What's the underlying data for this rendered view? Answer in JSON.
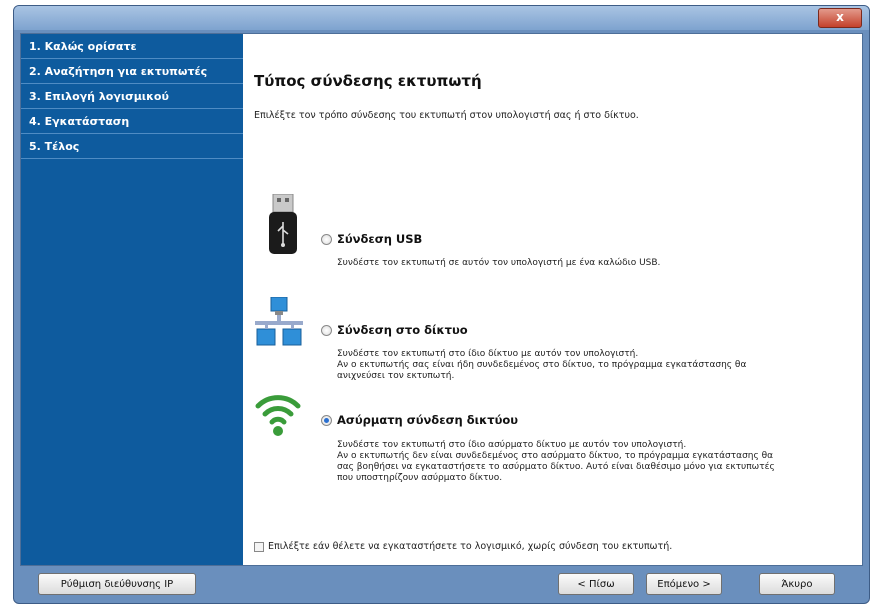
{
  "window": {
    "close_label": "x"
  },
  "sidebar": {
    "items": [
      {
        "label": "1. Καλώς ορίσατε"
      },
      {
        "label": "2. Αναζήτηση για εκτυπωτές"
      },
      {
        "label": "3. Επιλογή λογισμικού"
      },
      {
        "label": "4. Εγκατάσταση"
      },
      {
        "label": "5. Τέλος"
      }
    ]
  },
  "main": {
    "title": "Τύπος σύνδεσης εκτυπωτή",
    "subtitle": "Επιλέξτε τον τρόπο σύνδεσης του εκτυπωτή στον υπολογιστή σας ή στο δίκτυο.",
    "options": [
      {
        "label": "Σύνδεση USB",
        "desc": "Συνδέστε τον εκτυπωτή σε αυτόν τον υπολογιστή με ένα καλώδιο USB.",
        "icon": "usb-icon",
        "checked": false
      },
      {
        "label": "Σύνδεση στο δίκτυο",
        "desc": "Συνδέστε τον εκτυπωτή στο ίδιο δίκτυο με αυτόν τον υπολογιστή.\nΑν ο εκτυπωτής σας είναι ήδη συνδεδεμένος στο δίκτυο, το πρόγραμμα εγκατάστασης θα\nανιχνεύσει τον εκτυπωτή.",
        "icon": "network-icon",
        "checked": false
      },
      {
        "label": "Ασύρματη σύνδεση δικτύου",
        "desc": "Συνδέστε τον εκτυπωτή στο ίδιο ασύρματο δίκτυο με αυτόν τον υπολογιστή.\nΑν ο εκτυπωτής δεν είναι συνδεδεμένος στο ασύρματο δίκτυο, το πρόγραμμα εγκατάστασης θα\nσας βοηθήσει να εγκαταστήσετε το ασύρματο δίκτυο. Αυτό είναι διαθέσιμο μόνο για εκτυπωτές\nπου υποστηρίζουν ασύρματο δίκτυο.",
        "icon": "wifi-icon",
        "checked": true
      }
    ],
    "checkbox_label": "Επιλέξτε εάν θέλετε να εγκαταστήσετε το λογισμικό, χωρίς σύνδεση του εκτυπωτή."
  },
  "footer": {
    "ip_button": "Ρύθμιση διεύθυνσης IP",
    "back_button": "< Πίσω",
    "next_button": "Επόμενο >",
    "cancel_button": "Άκυρο"
  }
}
